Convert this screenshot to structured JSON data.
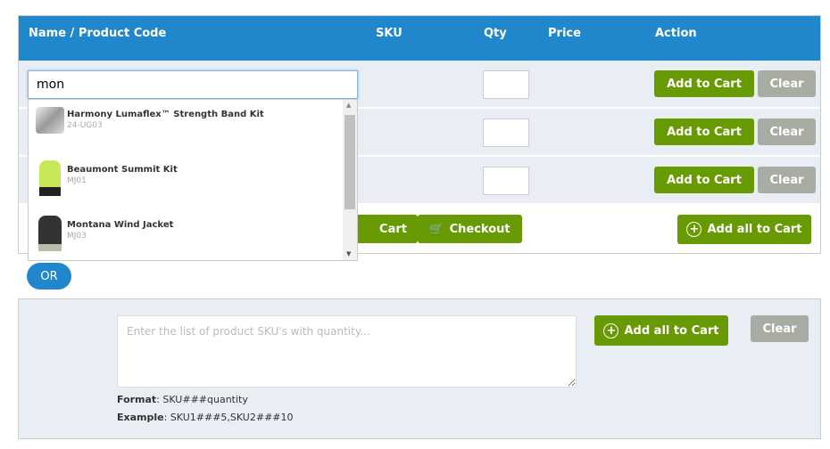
{
  "table": {
    "headers": {
      "name": "Name / Product Code",
      "sku": "SKU",
      "qty": "Qty",
      "price": "Price",
      "action": "Action"
    },
    "search_value": "mon",
    "add_to_cart": "Add to Cart",
    "clear": "Clear",
    "partial_button": "Cart",
    "checkout": "Checkout",
    "add_all": "Add all to Cart"
  },
  "autocomplete": [
    {
      "name": "Harmony Lumaflex™ Strength Band Kit",
      "sku": "24-UG03"
    },
    {
      "name": "Beaumont Summit Kit",
      "sku": "MJ01"
    },
    {
      "name": "Montana Wind Jacket",
      "sku": "MJ03"
    }
  ],
  "or_label": "OR",
  "bulk": {
    "placeholder": "Enter the list of product SKU's with quantity...",
    "add_all": "Add all to Cart",
    "clear": "Clear",
    "format_label": "Format",
    "format_value": ": SKU###quantity",
    "example_label": "Example",
    "example_value": ": SKU1###5,SKU2###10"
  },
  "colors": {
    "header": "#2187cc",
    "button_green": "#689a04",
    "button_grey": "#a9aca3"
  }
}
